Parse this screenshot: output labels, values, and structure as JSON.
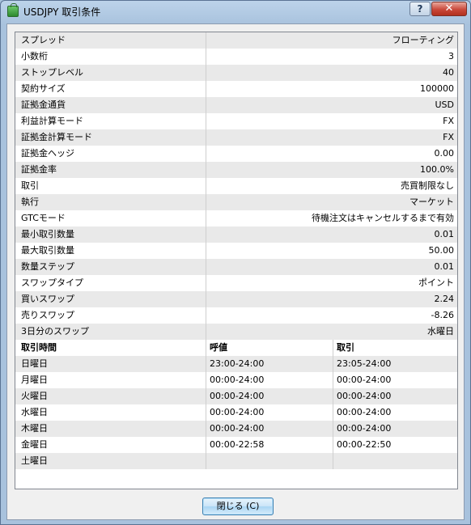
{
  "window": {
    "title": "USDJPY 取引条件",
    "help_label": "?",
    "close_label": "✕"
  },
  "specs": [
    {
      "label": "スプレッド",
      "value": "フローティング"
    },
    {
      "label": "小数桁",
      "value": "3"
    },
    {
      "label": "ストップレベル",
      "value": "40"
    },
    {
      "label": "契約サイズ",
      "value": "100000"
    },
    {
      "label": "証拠金通貨",
      "value": "USD"
    },
    {
      "label": "利益計算モード",
      "value": "FX"
    },
    {
      "label": "証拠金計算モード",
      "value": "FX"
    },
    {
      "label": "証拠金ヘッジ",
      "value": "0.00"
    },
    {
      "label": "証拠金率",
      "value": "100.0%"
    },
    {
      "label": "取引",
      "value": "売買制限なし"
    },
    {
      "label": "執行",
      "value": "マーケット"
    },
    {
      "label": "GTCモード",
      "value": "待機注文はキャンセルするまで有効"
    },
    {
      "label": "最小取引数量",
      "value": "0.01"
    },
    {
      "label": "最大取引数量",
      "value": "50.00"
    },
    {
      "label": "数量ステップ",
      "value": "0.01"
    },
    {
      "label": "スワップタイプ",
      "value": "ポイント"
    },
    {
      "label": "買いスワップ",
      "value": "2.24"
    },
    {
      "label": "売りスワップ",
      "value": "-8.26"
    },
    {
      "label": "3日分のスワップ",
      "value": "水曜日"
    }
  ],
  "sessions": {
    "headers": [
      "取引時間",
      "呼値",
      "取引"
    ],
    "rows": [
      [
        "日曜日",
        "23:00-24:00",
        "23:05-24:00"
      ],
      [
        "月曜日",
        "00:00-24:00",
        "00:00-24:00"
      ],
      [
        "火曜日",
        "00:00-24:00",
        "00:00-24:00"
      ],
      [
        "水曜日",
        "00:00-24:00",
        "00:00-24:00"
      ],
      [
        "木曜日",
        "00:00-24:00",
        "00:00-24:00"
      ],
      [
        "金曜日",
        "00:00-22:58",
        "00:00-22:50"
      ],
      [
        "土曜日",
        "",
        ""
      ]
    ]
  },
  "footer": {
    "close_button_label": "閉じる (C)"
  }
}
